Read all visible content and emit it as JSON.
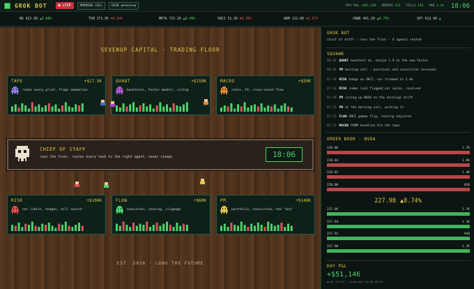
{
  "header": {
    "title": "GROK BOT",
    "live_label": "● LIVE",
    "buttons": [
      "MORNING CALL",
      "DESK @sevenup"
    ],
    "stats": [
      {
        "label": "DAY P&L",
        "value": "+$51,146"
      },
      {
        "label": "ORDERS",
        "value": "231"
      },
      {
        "label": "FILLS",
        "value": "136"
      },
      {
        "label": "VAR",
        "value": "1.4%"
      }
    ],
    "clock": "18:06"
  },
  "ticker": [
    {
      "sym": "NU",
      "price": "422.90",
      "chg": "▲3.08%",
      "dir": "up"
    },
    {
      "sym": "TSM",
      "price": "371.05",
      "chg": "▼0.64%",
      "dir": "dn"
    },
    {
      "sym": "META",
      "price": "715.29",
      "chg": "▲0.49%",
      "dir": "up"
    },
    {
      "sym": "SNCI",
      "price": "51.30",
      "chg": "▼0.50%",
      "dir": "dn"
    },
    {
      "sym": "ARM",
      "price": "122.06",
      "chg": "▼2.57%",
      "dir": "dn"
    },
    {
      "sym": "CRWD",
      "price": "491.20",
      "chg": "▲0.75%",
      "dir": "up"
    },
    {
      "sym": "SPY",
      "price": "612.40",
      "chg": "▲",
      "dir": "up"
    }
  ],
  "floor": {
    "title": "SEVENUP CAPITAL · TRADING FLOOR",
    "footer": "EST. 2026 · LONG THE FUTURE"
  },
  "desks": [
    {
      "name": "TAPE",
      "pnl": "+$17.5K",
      "desc": "reads every print, flags anomalies",
      "sprite_color": "#8a7be0",
      "bars": [
        0.5,
        0.7,
        0.4,
        0.8,
        0.6,
        0.3,
        0.9,
        0.5,
        0.7,
        0.4,
        0.6,
        0.8,
        0.5,
        0.7,
        0.3,
        0.6,
        0.9,
        0.5,
        0.4,
        0.7,
        0.6,
        0.8
      ],
      "bar_colors": [
        "g",
        "g",
        "r",
        "g",
        "g",
        "g",
        "r",
        "g",
        "g",
        "g",
        "g",
        "r",
        "g",
        "g",
        "g",
        "r",
        "g",
        "g",
        "g",
        "g",
        "r",
        "g"
      ]
    },
    {
      "name": "QUANT",
      "pnl": "+$159K",
      "desc": "backtests, factor models, sizing",
      "sprite_color": "#b05ad0",
      "bars": [
        0.6,
        0.4,
        0.8,
        0.5,
        0.7,
        0.9,
        0.4,
        0.6,
        0.8,
        0.5,
        0.7,
        0.3,
        0.6,
        0.9,
        0.5,
        0.7,
        0.4,
        0.8,
        0.6,
        0.5,
        0.7,
        0.9
      ],
      "bar_colors": [
        "g",
        "g",
        "g",
        "r",
        "g",
        "g",
        "g",
        "r",
        "g",
        "g",
        "g",
        "g",
        "r",
        "g",
        "g",
        "g",
        "g",
        "r",
        "g",
        "g",
        "g",
        "g"
      ]
    },
    {
      "name": "MACRO",
      "pnl": "+$50K",
      "desc": "rates, FX, cross-asset flow",
      "sprite_color": "#e08a3a",
      "bars": [
        0.4,
        0.6,
        0.5,
        0.8,
        0.3,
        0.7,
        0.5,
        0.9,
        0.4,
        0.6,
        0.7,
        0.5,
        0.8,
        0.4,
        0.6,
        0.5,
        0.7,
        0.3,
        0.6,
        0.8,
        0.5,
        0.4
      ],
      "bar_colors": [
        "g",
        "g",
        "r",
        "g",
        "g",
        "g",
        "r",
        "g",
        "g",
        "g",
        "g",
        "r",
        "g",
        "g",
        "g",
        "r",
        "g",
        "g",
        "g",
        "g",
        "r",
        "g"
      ]
    },
    {
      "name": "RISK",
      "pnl": "+$106K",
      "desc": "var limits, hedges, kill switch",
      "sprite_color": "#e04a4a",
      "bars": [
        0.6,
        0.5,
        0.8,
        0.4,
        0.7,
        0.6,
        0.9,
        0.5,
        0.4,
        0.7,
        0.6,
        0.8,
        0.5,
        0.3,
        0.7,
        0.6,
        0.9,
        0.5,
        0.4,
        0.6,
        0.8,
        0.5
      ],
      "bar_colors": [
        "g",
        "r",
        "g",
        "g",
        "r",
        "g",
        "g",
        "r",
        "g",
        "g",
        "r",
        "g",
        "g",
        "g",
        "r",
        "g",
        "g",
        "r",
        "g",
        "g",
        "g",
        "r"
      ]
    },
    {
      "name": "FLOW",
      "pnl": "+$60K",
      "desc": "execution, routing, slippage",
      "sprite_color": "#4fd36a",
      "bars": [
        0.7,
        0.5,
        0.9,
        0.6,
        0.4,
        0.8,
        0.5,
        0.7,
        0.6,
        0.9,
        0.4,
        0.6,
        0.8,
        0.5,
        0.7,
        0.9,
        0.6,
        0.4,
        0.8,
        0.5,
        0.7,
        0.6
      ],
      "bar_colors": [
        "g",
        "g",
        "r",
        "g",
        "g",
        "r",
        "g",
        "g",
        "g",
        "r",
        "g",
        "g",
        "r",
        "g",
        "g",
        "g",
        "r",
        "g",
        "g",
        "g",
        "r",
        "g"
      ]
    },
    {
      "name": "PM",
      "pnl": "+$146K",
      "desc": "portfolio, conviction, the \"why\"",
      "sprite_color": "#e0c64a",
      "bars": [
        0.5,
        0.7,
        0.4,
        0.8,
        0.6,
        0.5,
        0.9,
        0.6,
        0.4,
        0.7,
        0.5,
        0.8,
        0.6,
        0.4,
        0.9,
        0.7,
        0.5,
        0.6,
        0.8,
        0.4,
        0.7,
        0.5
      ],
      "bar_colors": [
        "g",
        "g",
        "g",
        "r",
        "g",
        "g",
        "g",
        "g",
        "r",
        "g",
        "g",
        "g",
        "g",
        "r",
        "g",
        "g",
        "g",
        "g",
        "r",
        "g",
        "g",
        "g"
      ]
    }
  ],
  "chief": {
    "title": "CHIEF OF STAFF",
    "desc": "runs the floor, routes every task to the right agent, never sleeps",
    "clock": "18:06"
  },
  "panel": {
    "grok_title": "GROK BOT",
    "grok_desc": "chief of staff · runs the floor · 6 agents seated",
    "squawk_title": "SQUAWK",
    "squawk": [
      {
        "t": "08:08",
        "who": "QUANT",
        "msg": "backtest ok, sharpe 1.9 on the new factor"
      },
      {
        "t": "08:02",
        "who": "PM",
        "msg": "morning call — positions and conviction reviewed"
      },
      {
        "t": "07:54",
        "who": "RISK",
        "msg": "hedge on SNCI, var trimmed to 1.4%"
      },
      {
        "t": "07:50",
        "who": "RISK",
        "msg": "comms rush flagged var spike, resolved"
      },
      {
        "t": "07:48",
        "who": "PM",
        "msg": "sizing up NVDA on the earnings drift"
      },
      {
        "t": "07:35",
        "who": "PM",
        "msg": "at the morning call, working it"
      },
      {
        "t": "07:32",
        "who": "FLOW",
        "msg": "SNCI gamma flip, routing adjusted"
      },
      {
        "t": "07:22",
        "who": "MACRO",
        "msg": "PAMM headline hit the tape"
      }
    ],
    "orderbook_title": "ORDER BOOK · NVDA",
    "asks": [
      {
        "price": "228.06",
        "size": "1.7K",
        "fill": 1.0
      },
      {
        "price": "228.04",
        "size": "1.9K",
        "fill": 1.0
      },
      {
        "price": "228.02",
        "size": "1.4K",
        "fill": 1.0
      },
      {
        "price": "228.00",
        "size": "630",
        "fill": 1.0
      }
    ],
    "mid": "227.98",
    "mid_chg": "▲8.74%",
    "bids": [
      {
        "price": "227.96",
        "size": "1.7K",
        "fill": 1.0
      },
      {
        "price": "227.94",
        "size": "1.1K",
        "fill": 1.0
      },
      {
        "price": "227.92",
        "size": "940",
        "fill": 1.0
      },
      {
        "price": "227.90",
        "size": "1.7K",
        "fill": 1.0
      }
    ],
    "pnl_title": "DAY P&L",
    "pnl_value": "+$51,146",
    "pnl_sub": "peak +$117K · premarket 04:00–09:30"
  },
  "colors": {
    "green": "#4fd36a",
    "red": "#e0545b",
    "gold": "#e0c64a",
    "ask_bar": "#b8474a",
    "bid_bar": "#3fb65a"
  }
}
